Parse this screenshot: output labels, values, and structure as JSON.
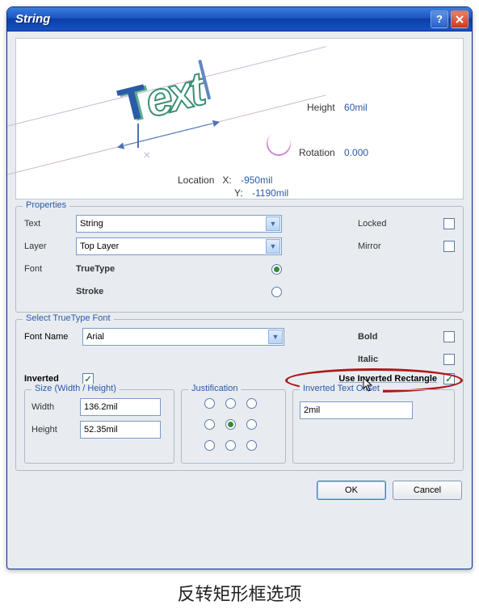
{
  "window": {
    "title": "String"
  },
  "preview": {
    "height_label": "Height",
    "height_value": "60mil",
    "rotation_label": "Rotation",
    "rotation_value": "0.000",
    "location_label": "Location",
    "x_label": "X:",
    "x_value": "-950mil",
    "y_label": "Y:",
    "y_value": "-1190mil",
    "sample_t": "T",
    "sample_ext": "ext"
  },
  "properties": {
    "group_label": "Properties",
    "text_label": "Text",
    "text_value": "String",
    "layer_label": "Layer",
    "layer_value": "Top Layer",
    "font_label": "Font",
    "truetype_label": "TrueType",
    "stroke_label": "Stroke",
    "locked_label": "Locked",
    "mirror_label": "Mirror"
  },
  "truetype": {
    "group_label": "Select TrueType Font",
    "fontname_label": "Font Name",
    "fontname_value": "Arial",
    "bold_label": "Bold",
    "italic_label": "Italic",
    "inverted_label": "Inverted",
    "use_inv_rect_label": "Use Inverted Rectangle",
    "size_group": "Size (Width / Height)",
    "width_label": "Width",
    "width_value": "136.2mil",
    "height_label": "Height",
    "height_value": "52.35mil",
    "justification_group": "Justification",
    "offset_group": "Inverted Text Offset",
    "offset_value": "2mil"
  },
  "buttons": {
    "ok": "OK",
    "cancel": "Cancel"
  },
  "caption": "反转矩形框选项"
}
